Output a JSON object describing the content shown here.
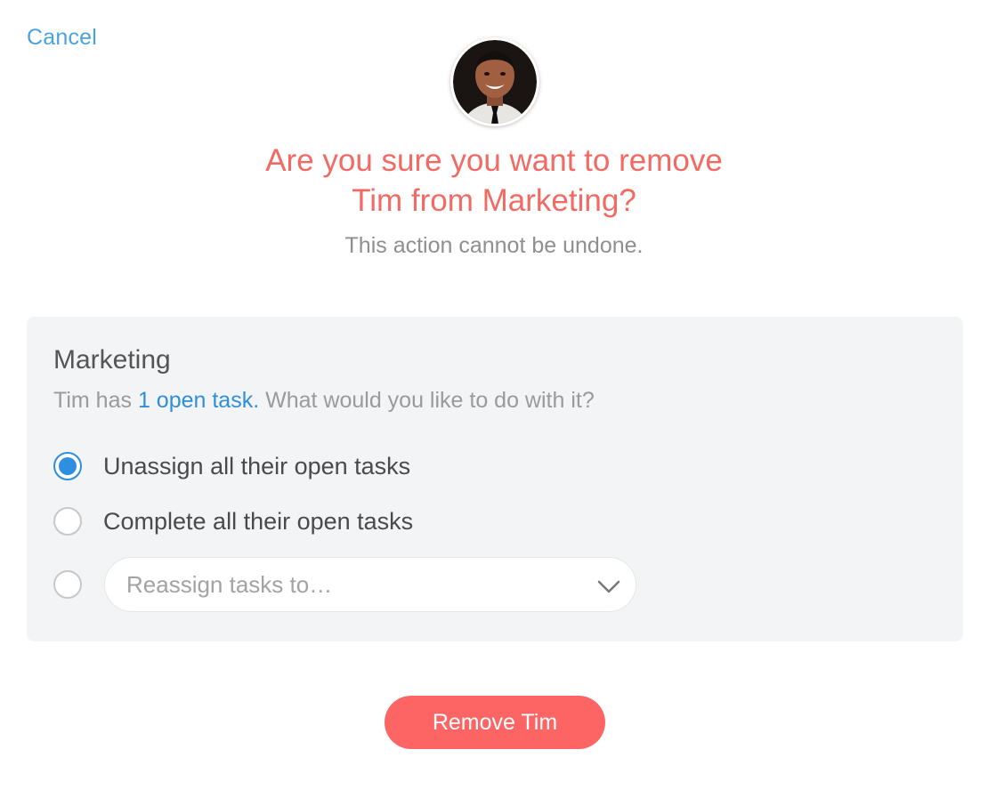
{
  "header": {
    "cancel_label": "Cancel"
  },
  "dialog": {
    "title_line1": "Are you sure you want to remove",
    "title_line2": "Tim from Marketing?",
    "subtitle": "This action cannot be undone."
  },
  "panel": {
    "team_name": "Marketing",
    "desc_prefix": "Tim has",
    "desc_link": "1 open task.",
    "desc_suffix": "What would you like to do with it?",
    "options": [
      {
        "label": "Unassign all their open tasks",
        "checked": true
      },
      {
        "label": "Complete all their open tasks",
        "checked": false
      },
      {
        "label": "",
        "checked": false
      }
    ],
    "reassign_placeholder": "Reassign tasks to…"
  },
  "actions": {
    "remove_label": "Remove Tim"
  },
  "colors": {
    "accent": "#2e8fe0",
    "danger": "#fd6464",
    "title": "#f26a63",
    "link": "#4aa3df"
  }
}
